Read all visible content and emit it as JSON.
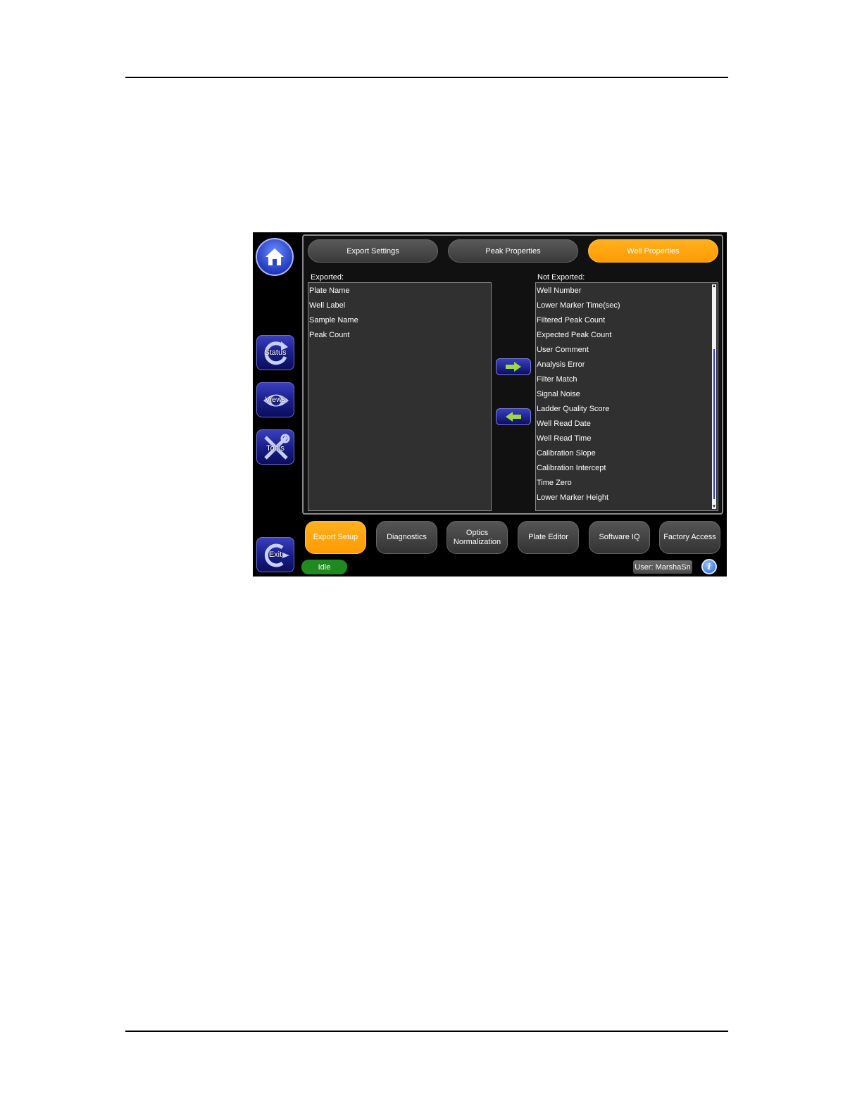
{
  "nav": {
    "status_label": "Status",
    "views_label": "Views",
    "tools_label": "Tools",
    "exit_label": "Exit"
  },
  "tabs": [
    {
      "label": "Export Settings"
    },
    {
      "label": "Peak Properties"
    },
    {
      "label": "Well Properties"
    }
  ],
  "exported": {
    "caption": "Exported:",
    "items": [
      "Plate Name",
      "Well Label",
      "Sample Name",
      "Peak Count"
    ]
  },
  "not_exported": {
    "caption": "Not Exported:",
    "items": [
      "Well Number",
      "Lower Marker Time(sec)",
      "Filtered Peak Count",
      "Expected Peak Count",
      "User Comment",
      "Analysis Error",
      "Filter Match",
      "Signal Noise",
      "Ladder Quality Score",
      "Well Read Date",
      "Well Read Time",
      "Calibration Slope",
      "Calibration Intercept",
      "Time Zero",
      "Lower Marker Height"
    ]
  },
  "bottom_tabs": [
    {
      "label": "Export Setup"
    },
    {
      "label": "Diagnostics"
    },
    {
      "label": "Optics Normalization"
    },
    {
      "label": "Plate Editor"
    },
    {
      "label": "Software IQ"
    },
    {
      "label": "Factory Access"
    }
  ],
  "status": {
    "text": "Idle",
    "color": "#1f8a1f"
  },
  "user": {
    "text": "User: MarshaSn"
  },
  "info": {
    "glyph": "i"
  },
  "colors": {
    "accent": "#ff9b00",
    "nav_blue": "#1a1f8a"
  }
}
